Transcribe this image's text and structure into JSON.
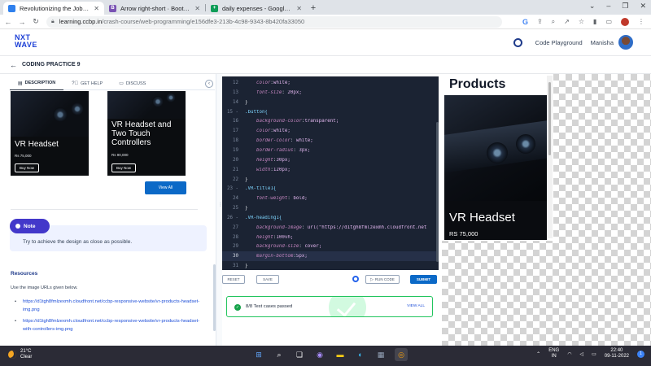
{
  "browser": {
    "tabs": [
      {
        "title": "Revolutionizing the Job Market |",
        "fav_color": "#2f80ed",
        "fav_glyph": "",
        "active": true
      },
      {
        "title": "Arrow right-short · Bootstrap Icons",
        "fav_color": "#7952b3",
        "fav_glyph": "B",
        "active": false
      },
      {
        "title": "daily expenses - Google Sheets",
        "fav_color": "#0f9d58",
        "fav_glyph": "+",
        "active": false
      }
    ],
    "new_tab": "+",
    "url_host": "learning.ccbp.in",
    "url_path": "/crash-course/web-programming/e156dfe3-213b-4c98-9343-8b420fa33050"
  },
  "app": {
    "logo_top": "NXT",
    "logo_bottom": "WAVE",
    "code_playground": "Code Playground",
    "user_name": "Manisha",
    "back_title": "CODING PRACTICE 9"
  },
  "left": {
    "tabs": [
      {
        "label": "DESCRIPTION",
        "icon": "page-icon",
        "active": true
      },
      {
        "label": "GET HELP",
        "icon": "help-icon",
        "active": false
      },
      {
        "label": "DISCUSS",
        "icon": "chat-icon",
        "active": false
      }
    ],
    "collapse_glyph": "‹",
    "cards": [
      {
        "title": "VR Headset",
        "price": "Rs 75,000",
        "button": "Buy Now"
      },
      {
        "title": "VR Headset and Two Touch Controllers",
        "price": "Rs 90,000",
        "button": "Buy Now"
      }
    ],
    "view_all": "View All",
    "note_label": "Note",
    "note_text": "Try to achieve the design as close as possible.",
    "resources_title": "Resources",
    "resources_intro": "Use the image URLs given below.",
    "resource_links": [
      "https://d1tgh8fmlzexmh.cloudfront.net/ccbp-responsive-website/vr-products-headset-img.png",
      "https://d1tgh8fmlzexmh.cloudfront.net/ccbp-responsive-website/vr-products-headset-with-controllers-img.png"
    ]
  },
  "editor": {
    "lines": [
      {
        "n": "12",
        "code": "    color:white;"
      },
      {
        "n": "13",
        "code": "    font-size: 20px;"
      },
      {
        "n": "14",
        "code": "}"
      },
      {
        "n": "15 -",
        "code": ".button{"
      },
      {
        "n": "16",
        "code": "    background-color:transparent;"
      },
      {
        "n": "17",
        "code": "    color:white;"
      },
      {
        "n": "18",
        "code": "    border-color: white;"
      },
      {
        "n": "19",
        "code": "    border-radius: 3px;"
      },
      {
        "n": "20",
        "code": "    height:30px;"
      },
      {
        "n": "21",
        "code": "    width:120px;"
      },
      {
        "n": "22",
        "code": "}"
      },
      {
        "n": "23 -",
        "code": ".VR-title1{"
      },
      {
        "n": "24",
        "code": "    font-weight: bold;"
      },
      {
        "n": "25",
        "code": "}"
      },
      {
        "n": "26 -",
        "code": ".VR-heading1{"
      },
      {
        "n": "27",
        "code": "    background-image: url(\"https://d1tgh8fmlzexmh.cloudfront.net"
      },
      {
        "n": "28",
        "code": "    height:100vh;"
      },
      {
        "n": "29",
        "code": "    background-size: cover;"
      },
      {
        "n": "30",
        "code": "    margin-bottom:5px;"
      },
      {
        "n": "31",
        "code": "}"
      }
    ],
    "highlight_line": "30",
    "reset": "RESET",
    "save": "SAVE",
    "run_code": "RUN CODE",
    "submit": "SUBMIT",
    "result_text": "8/8 Test cases passed",
    "view_all": "VIEW ALL"
  },
  "output": {
    "title": "Products",
    "card_title": "VR Headset",
    "card_price": "RS 75,000"
  },
  "taskbar": {
    "temp": "21°C",
    "weather": "Clear",
    "lang_top": "ENG",
    "lang_bottom": "IN",
    "time": "22:40",
    "date": "09-11-2022",
    "notifications": "1"
  }
}
